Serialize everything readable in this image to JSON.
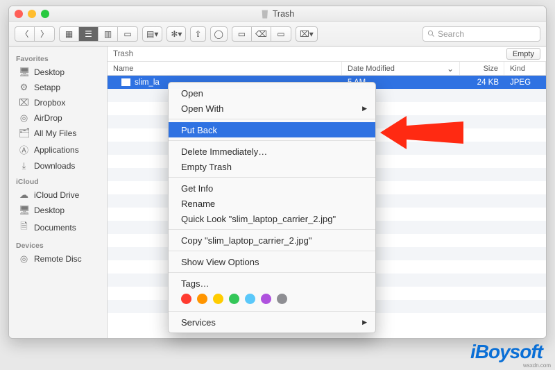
{
  "window": {
    "title": "Trash"
  },
  "toolbar": {
    "search_placeholder": "Search"
  },
  "pathbar": {
    "location": "Trash",
    "empty_button": "Empty"
  },
  "columns": {
    "name": "Name",
    "date": "Date Modified",
    "size": "Size",
    "kind": "Kind"
  },
  "sidebar": {
    "groups": [
      {
        "title": "Favorites",
        "items": [
          {
            "icon": "🖥",
            "label": "Desktop"
          },
          {
            "icon": "⚙",
            "label": "Setapp"
          },
          {
            "icon": "⌧",
            "label": "Dropbox"
          },
          {
            "icon": "◎",
            "label": "AirDrop"
          },
          {
            "icon": "🗂",
            "label": "All My Files"
          },
          {
            "icon": "Ⓐ",
            "label": "Applications"
          },
          {
            "icon": "⤓",
            "label": "Downloads"
          }
        ]
      },
      {
        "title": "iCloud",
        "items": [
          {
            "icon": "☁",
            "label": "iCloud Drive"
          },
          {
            "icon": "🖥",
            "label": "Desktop"
          },
          {
            "icon": "🗎",
            "label": "Documents"
          }
        ]
      },
      {
        "title": "Devices",
        "items": [
          {
            "icon": "◎",
            "label": "Remote Disc"
          }
        ]
      }
    ]
  },
  "files": [
    {
      "name": "slim_la",
      "date": "5 AM",
      "size": "24 KB",
      "kind": "JPEG"
    }
  ],
  "context_menu": {
    "items": [
      {
        "label": "Open",
        "type": "item"
      },
      {
        "label": "Open With",
        "type": "submenu"
      },
      {
        "type": "sep"
      },
      {
        "label": "Put Back",
        "type": "item",
        "selected": true
      },
      {
        "type": "sep"
      },
      {
        "label": "Delete Immediately…",
        "type": "item"
      },
      {
        "label": "Empty Trash",
        "type": "item"
      },
      {
        "type": "sep"
      },
      {
        "label": "Get Info",
        "type": "item"
      },
      {
        "label": "Rename",
        "type": "item"
      },
      {
        "label": "Quick Look \"slim_laptop_carrier_2.jpg\"",
        "type": "item"
      },
      {
        "type": "sep"
      },
      {
        "label": "Copy \"slim_laptop_carrier_2.jpg\"",
        "type": "item"
      },
      {
        "type": "sep"
      },
      {
        "label": "Show View Options",
        "type": "item"
      },
      {
        "type": "sep"
      },
      {
        "label": "Tags…",
        "type": "item"
      },
      {
        "type": "tags",
        "colors": [
          "#ff3b30",
          "#ff9500",
          "#ffcc00",
          "#34c759",
          "#5ac8fa",
          "#af52de",
          "#8e8e93"
        ]
      },
      {
        "type": "sep"
      },
      {
        "label": "Services",
        "type": "submenu"
      }
    ]
  },
  "branding": {
    "logo": "iBoysoft",
    "source": "wsxdn.com"
  }
}
